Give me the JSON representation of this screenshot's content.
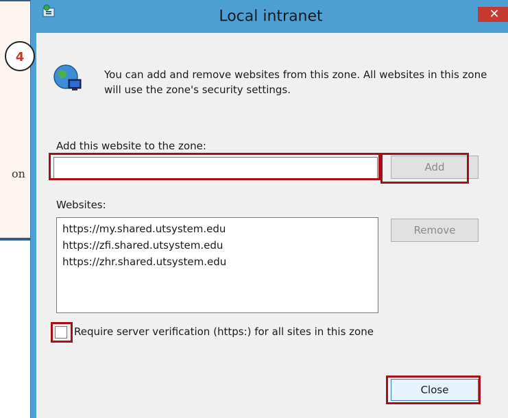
{
  "background": {
    "partial_text": "on",
    "step_number": "4"
  },
  "window": {
    "title": "Local intranet",
    "close_glyph": "✕",
    "icon": "zone-icon"
  },
  "intro": {
    "icon": "globe-computer-icon",
    "text": "You can add and remove websites from this zone. All websites in this zone will use the zone's security settings."
  },
  "add_section": {
    "label": "Add this website to the zone:",
    "input_value": "",
    "add_button": "Add"
  },
  "websites": {
    "label": "Websites:",
    "items": [
      "https://my.shared.utsystem.edu",
      "https://zfi.shared.utsystem.edu",
      "https://zhr.shared.utsystem.edu"
    ],
    "remove_button": "Remove"
  },
  "require_verification": {
    "label": "Require server verification (https:) for all sites in this zone",
    "checked": false
  },
  "footer": {
    "close_button": "Close"
  },
  "colors": {
    "title_bar": "#4e9fd4",
    "close_button_bg": "#c7382f",
    "highlight": "#a50f1a",
    "panel_bg": "#f0f0f0"
  }
}
